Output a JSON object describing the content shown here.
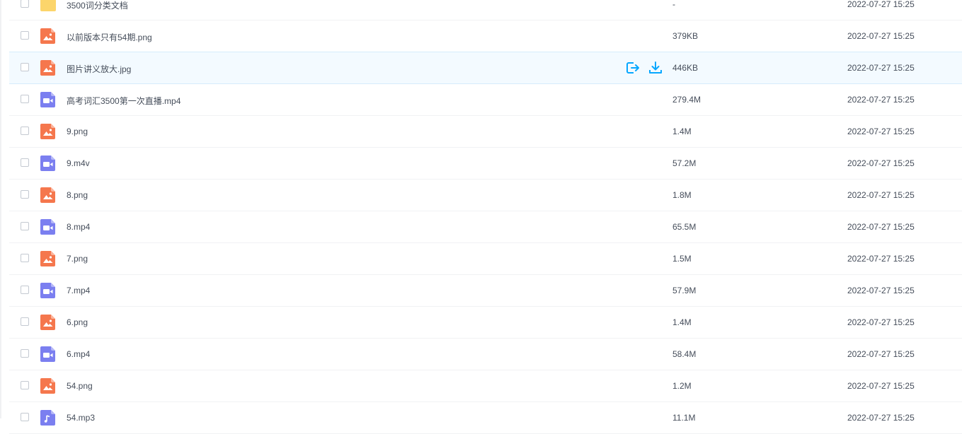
{
  "colors": {
    "image_icon": "#f5774d",
    "video_icon": "#7b7ff0",
    "folder_icon": "#fcd56b",
    "action_blue": "#06a7ff"
  },
  "files": [
    {
      "name": "3500词分类文档",
      "type": "folder",
      "icon": "folder-icon",
      "size": "-",
      "date": "2022-07-27 15:25"
    },
    {
      "name": "以前版本只有54期.png",
      "type": "image",
      "icon": "image-file-icon",
      "size": "379KB",
      "date": "2022-07-27 15:25"
    },
    {
      "name": "图片讲义放大.jpg",
      "type": "image",
      "icon": "image-file-icon",
      "size": "446KB",
      "date": "2022-07-27 15:25",
      "hovered": true
    },
    {
      "name": "高考词汇3500第一次直播.mp4",
      "type": "video",
      "icon": "video-file-icon",
      "size": "279.4M",
      "date": "2022-07-27 15:25"
    },
    {
      "name": "9.png",
      "type": "image",
      "icon": "image-file-icon",
      "size": "1.4M",
      "date": "2022-07-27 15:25"
    },
    {
      "name": "9.m4v",
      "type": "video",
      "icon": "video-file-icon",
      "size": "57.2M",
      "date": "2022-07-27 15:25"
    },
    {
      "name": "8.png",
      "type": "image",
      "icon": "image-file-icon",
      "size": "1.8M",
      "date": "2022-07-27 15:25"
    },
    {
      "name": "8.mp4",
      "type": "video",
      "icon": "video-file-icon",
      "size": "65.5M",
      "date": "2022-07-27 15:25"
    },
    {
      "name": "7.png",
      "type": "image",
      "icon": "image-file-icon",
      "size": "1.5M",
      "date": "2022-07-27 15:25"
    },
    {
      "name": "7.mp4",
      "type": "video",
      "icon": "video-file-icon",
      "size": "57.9M",
      "date": "2022-07-27 15:25"
    },
    {
      "name": "6.png",
      "type": "image",
      "icon": "image-file-icon",
      "size": "1.4M",
      "date": "2022-07-27 15:25"
    },
    {
      "name": "6.mp4",
      "type": "video",
      "icon": "video-file-icon",
      "size": "58.4M",
      "date": "2022-07-27 15:25"
    },
    {
      "name": "54.png",
      "type": "image",
      "icon": "image-file-icon",
      "size": "1.2M",
      "date": "2022-07-27 15:25"
    },
    {
      "name": "54.mp3",
      "type": "audio",
      "icon": "audio-file-icon",
      "size": "11.1M",
      "date": "2022-07-27 15:25"
    }
  ],
  "hover_actions": [
    {
      "icon": "share-icon"
    },
    {
      "icon": "download-icon"
    }
  ]
}
